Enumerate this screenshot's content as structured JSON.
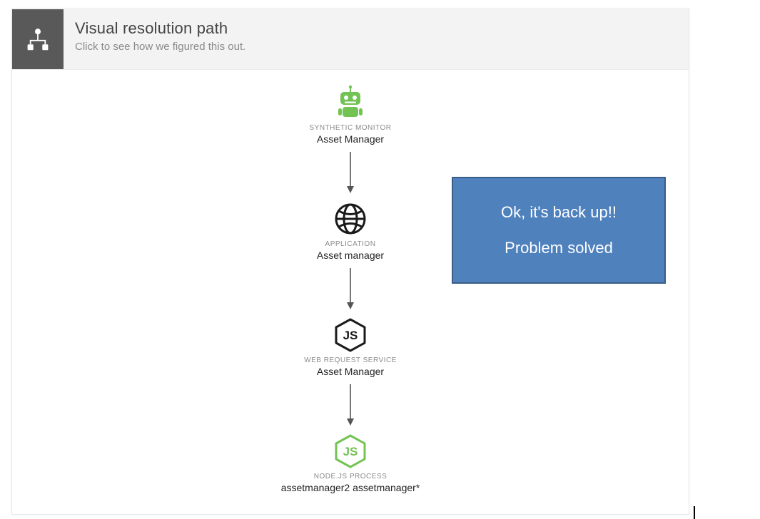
{
  "header": {
    "title": "Visual resolution path",
    "subtitle": "Click to see how we figured this out."
  },
  "chain": [
    {
      "type": "SYNTHETIC MONITOR",
      "name": "Asset Manager",
      "icon": "robot",
      "color": "#73C354"
    },
    {
      "type": "APPLICATION",
      "name": "Asset manager",
      "icon": "globe",
      "color": "#1a1a1a"
    },
    {
      "type": "WEB REQUEST SERVICE",
      "name": "Asset Manager",
      "icon": "nodejs",
      "color": "#1a1a1a"
    },
    {
      "type": "NODE.JS PROCESS",
      "name": "assetmanager2 assetmanager*",
      "icon": "nodejs",
      "color": "#73C354"
    }
  ],
  "callout": {
    "line1": "Ok, it's back up!!",
    "line2": "Problem solved"
  }
}
